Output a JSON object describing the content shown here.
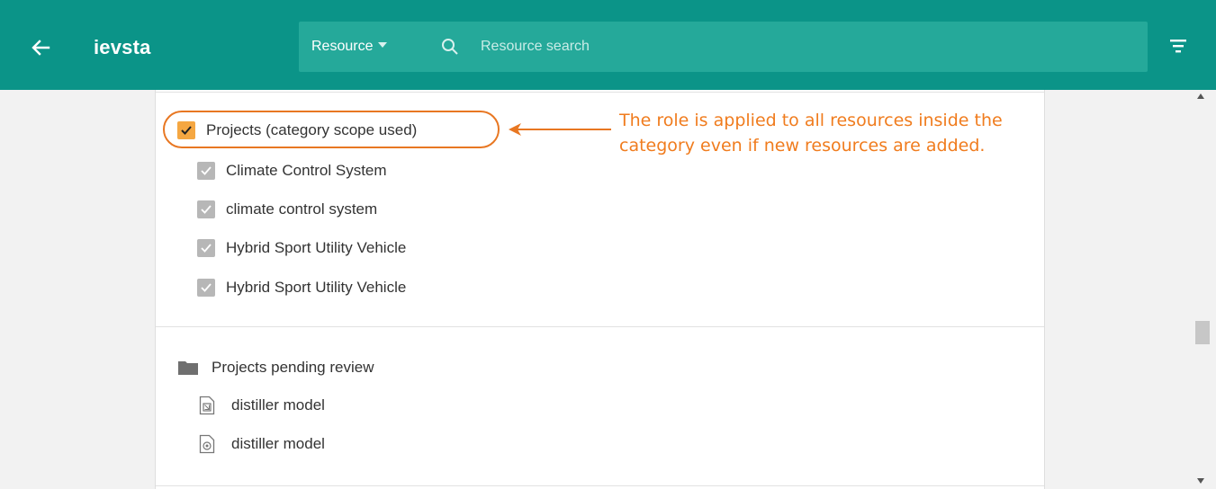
{
  "header": {
    "back_icon": "arrow-left-icon",
    "app_title": "ievsta",
    "search": {
      "scope_label": "Resource",
      "placeholder": "Resource search",
      "value": ""
    },
    "filter_icon": "filter-icon",
    "accent_color": "#0b9488"
  },
  "category": {
    "label": "Projects (category scope used)",
    "checked": true,
    "check_color": "#f5a742",
    "items": [
      {
        "label": "Climate Control System",
        "checked": true
      },
      {
        "label": "climate control system",
        "checked": true
      },
      {
        "label": "Hybrid Sport Utility Vehicle",
        "checked": true
      },
      {
        "label": "Hybrid Sport Utility Vehicle",
        "checked": true
      }
    ]
  },
  "annotation": {
    "line1": "The role is applied to all resources inside the",
    "line2": "category even if new resources are added.",
    "color": "#f07c1e"
  },
  "pending": {
    "folder_icon": "folder-icon",
    "label": "Projects pending review",
    "files": [
      {
        "icon": "model-file-icon",
        "label": "distiller model"
      },
      {
        "icon": "gear-file-icon",
        "label": "distiller model"
      }
    ]
  }
}
